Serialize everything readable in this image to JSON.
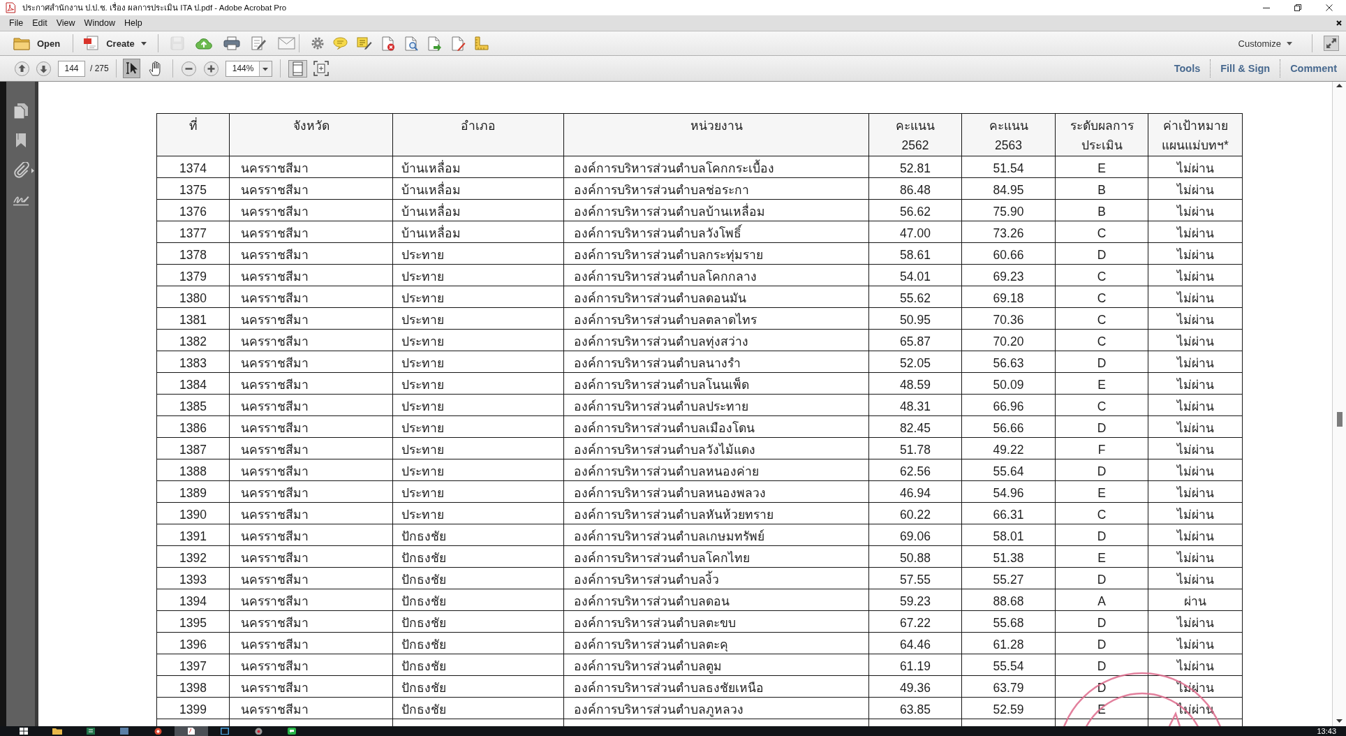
{
  "window": {
    "title": "ประกาศสำนักงาน ป.ป.ช. เรื่อง ผลการประเมิน ITA ป.pdf - Adobe Acrobat Pro"
  },
  "menu": [
    "File",
    "Edit",
    "View",
    "Window",
    "Help"
  ],
  "toolbar": {
    "open": "Open",
    "create": "Create",
    "file_tools": [
      {
        "kind": "save",
        "disabled": true
      },
      {
        "kind": "cloud",
        "disabled": false
      },
      {
        "kind": "print",
        "disabled": false
      },
      {
        "kind": "sign",
        "disabled": false
      },
      {
        "kind": "mail",
        "disabled": false
      }
    ],
    "quick_tools": [
      {
        "kind": "gear",
        "disabled": false
      },
      {
        "kind": "bubble",
        "disabled": false
      },
      {
        "kind": "highlight",
        "disabled": false
      },
      {
        "kind": "doc_delete",
        "disabled": false
      },
      {
        "kind": "doc_search",
        "disabled": false
      },
      {
        "kind": "doc_export",
        "disabled": false
      },
      {
        "kind": "doc_edit",
        "disabled": false
      },
      {
        "kind": "ruler",
        "disabled": false
      }
    ],
    "customize": "Customize"
  },
  "navigation": {
    "page": "144",
    "page_count": "/ 275",
    "tools": [
      {
        "kind": "select",
        "selected": true
      },
      {
        "kind": "hand",
        "selected": false
      }
    ],
    "zoom": "144%"
  },
  "panes": [
    "Tools",
    "Fill & Sign",
    "Comment"
  ],
  "sidebar": [
    {
      "kind": "pages"
    },
    {
      "kind": "bookmarks"
    },
    {
      "kind": "attachments"
    },
    {
      "kind": "signatures"
    }
  ],
  "table": {
    "columns": [
      "ที่",
      "จังหวัด",
      "อำเภอ",
      "หน่วยงาน",
      "คะแนน 2562",
      "คะแนน 2563",
      "ระดับผลการ ประเมิน",
      "ค่าเป้าหมาย แผนแม่บทฯ*"
    ],
    "rows": [
      [
        "1374",
        "นครราชสีมา",
        "บ้านเหลื่อม",
        "องค์การบริหารส่วนตำบลโคกกระเบื้อง",
        "52.81",
        "51.54",
        "E",
        "ไม่ผ่าน"
      ],
      [
        "1375",
        "นครราชสีมา",
        "บ้านเหลื่อม",
        "องค์การบริหารส่วนตำบลช่อระกา",
        "86.48",
        "84.95",
        "B",
        "ไม่ผ่าน"
      ],
      [
        "1376",
        "นครราชสีมา",
        "บ้านเหลื่อม",
        "องค์การบริหารส่วนตำบลบ้านเหลื่อม",
        "56.62",
        "75.90",
        "B",
        "ไม่ผ่าน"
      ],
      [
        "1377",
        "นครราชสีมา",
        "บ้านเหลื่อม",
        "องค์การบริหารส่วนตำบลวังโพธิ์",
        "47.00",
        "73.26",
        "C",
        "ไม่ผ่าน"
      ],
      [
        "1378",
        "นครราชสีมา",
        "ประทาย",
        "องค์การบริหารส่วนตำบลกระทุ่มราย",
        "58.61",
        "60.66",
        "D",
        "ไม่ผ่าน"
      ],
      [
        "1379",
        "นครราชสีมา",
        "ประทาย",
        "องค์การบริหารส่วนตำบลโคกกลาง",
        "54.01",
        "69.23",
        "C",
        "ไม่ผ่าน"
      ],
      [
        "1380",
        "นครราชสีมา",
        "ประทาย",
        "องค์การบริหารส่วนตำบลดอนมัน",
        "55.62",
        "69.18",
        "C",
        "ไม่ผ่าน"
      ],
      [
        "1381",
        "นครราชสีมา",
        "ประทาย",
        "องค์การบริหารส่วนตำบลตลาดไทร",
        "50.95",
        "70.36",
        "C",
        "ไม่ผ่าน"
      ],
      [
        "1382",
        "นครราชสีมา",
        "ประทาย",
        "องค์การบริหารส่วนตำบลทุ่งสว่าง",
        "65.87",
        "70.20",
        "C",
        "ไม่ผ่าน"
      ],
      [
        "1383",
        "นครราชสีมา",
        "ประทาย",
        "องค์การบริหารส่วนตำบลนางรำ",
        "52.05",
        "56.63",
        "D",
        "ไม่ผ่าน"
      ],
      [
        "1384",
        "นครราชสีมา",
        "ประทาย",
        "องค์การบริหารส่วนตำบลโนนเพ็ด",
        "48.59",
        "50.09",
        "E",
        "ไม่ผ่าน"
      ],
      [
        "1385",
        "นครราชสีมา",
        "ประทาย",
        "องค์การบริหารส่วนตำบลประทาย",
        "48.31",
        "66.96",
        "C",
        "ไม่ผ่าน"
      ],
      [
        "1386",
        "นครราชสีมา",
        "ประทาย",
        "องค์การบริหารส่วนตำบลเมืองโดน",
        "82.45",
        "56.66",
        "D",
        "ไม่ผ่าน"
      ],
      [
        "1387",
        "นครราชสีมา",
        "ประทาย",
        "องค์การบริหารส่วนตำบลวังไม้แดง",
        "51.78",
        "49.22",
        "F",
        "ไม่ผ่าน"
      ],
      [
        "1388",
        "นครราชสีมา",
        "ประทาย",
        "องค์การบริหารส่วนตำบลหนองค่าย",
        "62.56",
        "55.64",
        "D",
        "ไม่ผ่าน"
      ],
      [
        "1389",
        "นครราชสีมา",
        "ประทาย",
        "องค์การบริหารส่วนตำบลหนองพลวง",
        "46.94",
        "54.96",
        "E",
        "ไม่ผ่าน"
      ],
      [
        "1390",
        "นครราชสีมา",
        "ประทาย",
        "องค์การบริหารส่วนตำบลหันห้วยทราย",
        "60.22",
        "66.31",
        "C",
        "ไม่ผ่าน"
      ],
      [
        "1391",
        "นครราชสีมา",
        "ปักธงชัย",
        "องค์การบริหารส่วนตำบลเกษมทรัพย์",
        "69.06",
        "58.01",
        "D",
        "ไม่ผ่าน"
      ],
      [
        "1392",
        "นครราชสีมา",
        "ปักธงชัย",
        "องค์การบริหารส่วนตำบลโคกไทย",
        "50.88",
        "51.38",
        "E",
        "ไม่ผ่าน"
      ],
      [
        "1393",
        "นครราชสีมา",
        "ปักธงชัย",
        "องค์การบริหารส่วนตำบลงิ้ว",
        "57.55",
        "55.27",
        "D",
        "ไม่ผ่าน"
      ],
      [
        "1394",
        "นครราชสีมา",
        "ปักธงชัย",
        "องค์การบริหารส่วนตำบลดอน",
        "59.23",
        "88.68",
        "A",
        "ผ่าน"
      ],
      [
        "1395",
        "นครราชสีมา",
        "ปักธงชัย",
        "องค์การบริหารส่วนตำบลตะขบ",
        "67.22",
        "55.68",
        "D",
        "ไม่ผ่าน"
      ],
      [
        "1396",
        "นครราชสีมา",
        "ปักธงชัย",
        "องค์การบริหารส่วนตำบลตะคุ",
        "64.46",
        "61.28",
        "D",
        "ไม่ผ่าน"
      ],
      [
        "1397",
        "นครราชสีมา",
        "ปักธงชัย",
        "องค์การบริหารส่วนตำบลตูม",
        "61.19",
        "55.54",
        "D",
        "ไม่ผ่าน"
      ],
      [
        "1398",
        "นครราชสีมา",
        "ปักธงชัย",
        "องค์การบริหารส่วนตำบลธงชัยเหนือ",
        "49.36",
        "63.79",
        "D",
        "ไม่ผ่าน"
      ],
      [
        "1399",
        "นครราชสีมา",
        "ปักธงชัย",
        "องค์การบริหารส่วนตำบลภูหลวง",
        "63.85",
        "52.59",
        "E",
        "ไม่ผ่าน"
      ]
    ]
  },
  "taskbar": {
    "items": [
      {
        "kind": "start",
        "selected": false
      },
      {
        "kind": "folder",
        "selected": false
      },
      {
        "kind": "sheet",
        "selected": false
      },
      {
        "kind": "app",
        "selected": false
      },
      {
        "kind": "globe",
        "selected": false
      },
      {
        "kind": "pdf",
        "selected": true
      },
      {
        "kind": "window",
        "selected": false
      },
      {
        "kind": "disc",
        "selected": false
      },
      {
        "kind": "chat",
        "selected": false
      }
    ],
    "clock": "13:43"
  }
}
